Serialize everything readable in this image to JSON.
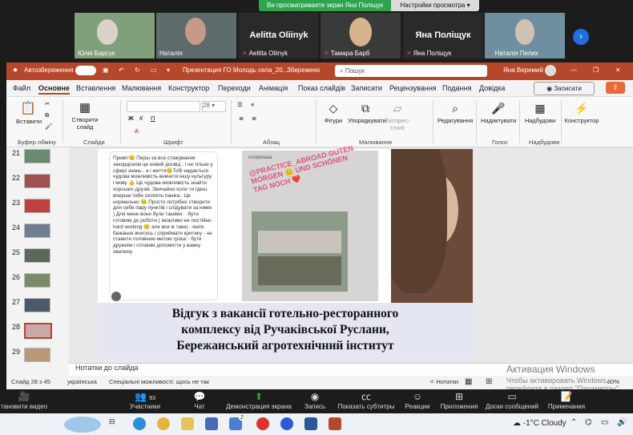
{
  "zoom": {
    "share_banner": "Ви просматриваете экран Яна Поліщук",
    "view_settings": "Настройки просмотра",
    "participants_tiles": [
      {
        "name": "Юлія Барсук",
        "muted": false
      },
      {
        "name": "Наталія",
        "muted": false
      },
      {
        "name": "Aelitta Oliinyk",
        "big": "Aelitta Oliinyk",
        "muted": true
      },
      {
        "name": "Тамара Барб",
        "muted": true
      },
      {
        "name": "Яна Поліщук",
        "big": "Яна Поліщук",
        "muted": true
      },
      {
        "name": "Наталія Пелих",
        "muted": true
      }
    ],
    "bottom_bar": {
      "video": "тановити видео",
      "participants": "Участники",
      "participants_count": "93",
      "chat": "Чат",
      "share": "Демонстрация экрана",
      "record": "Запись",
      "captions": "Показать субтитры",
      "reactions": "Реакции",
      "apps": "Приложения",
      "whiteboards": "Доски сообщений",
      "notes": "Примечания"
    }
  },
  "ppt": {
    "autosave": "Автозбереження",
    "file_title": "Презентация ГО Молодь села_20...",
    "saved": "Збережено",
    "search_placeholder": "Пошук",
    "user": "Яна Веремий",
    "tabs": [
      "Файл",
      "Основне",
      "Вставлення",
      "Малювання",
      "Конструктор",
      "Переходи",
      "Анімація",
      "Показ слайдів",
      "Записати",
      "Рецензування",
      "Подання",
      "Довідка"
    ],
    "active_tab": 1,
    "record_button": "Записати",
    "ribbon": {
      "paste": "Вставити",
      "clipboard": "Буфер обміну",
      "new_slide": "Створити слайд",
      "slides": "Слайди",
      "font_group": "Шрифт",
      "font_size": "28",
      "paragraph": "Абзац",
      "shapes": "Фігури",
      "arrange": "Упорядкувати",
      "quick_styles": "Експрес-стилі",
      "drawing": "Малювання",
      "editing": "Редагування",
      "dictate": "Надиктувати",
      "voice": "Голос",
      "addins": "Надбудови",
      "addins_group": "Надбудови",
      "designer": "Конструктор"
    },
    "thumbnail_numbers": [
      "21",
      "22",
      "23",
      "24",
      "25",
      "26",
      "27",
      "28",
      "29",
      "30"
    ],
    "slide": {
      "chat_text": "Привіт😊 Перш за все стажування закордоном це новий досвід . І не тільки у сфері знань , а і життя😊Тобі надається чудова можливість вивчити іншу культуру і мову 👍 Це чудова можливість знайти хороших друзів. Звичайно коли ти їдеш вперше тебе охопить паніка.. Це нормально 😊 Просто потрібно створити для себе пару пунктів і слідувати за ними ) Для мене вони були такими : -бути готовим до роботи ( можливо не постійно hard working 😊 але все ж таки) - мати бажання вчитись і сприймати критику - не ставити головною метою гроші - бути дружнім і готовим допомогти у важку хвилину",
      "story_user": "ruslankaaa",
      "story_caption": "@PRACTICE_ABROAD GUTEN MORGEN 😊 UND SCHÖNEN TAG NOCH ❤️",
      "caption_line1": "Відгук з вакансії готельно-ресторанного",
      "caption_line2": "комплексу від Ручаківської Руслани,",
      "caption_line3": "Бережанський агротехнічний інститут"
    },
    "notes_label": "Нотатки до слайда",
    "status": {
      "slide": "Слайд 28 з 45",
      "language": "українська",
      "accessibility": "Спеціальні можливості: щось не так",
      "notes": "Нотатки",
      "zoom": "60%"
    }
  },
  "watermark": {
    "line1": "Активация Windows",
    "line2": "Чтобы активировать Windows, перейдите в раздел \"Параметры\"."
  },
  "taskbar": {
    "weather": "-1°C Cloudy",
    "mail_badge": "2"
  },
  "colors": {
    "ppt_accent": "#b7472a",
    "zoom_share_green": "#2da44e",
    "slide_caption_bg": "#e4e6f2"
  }
}
